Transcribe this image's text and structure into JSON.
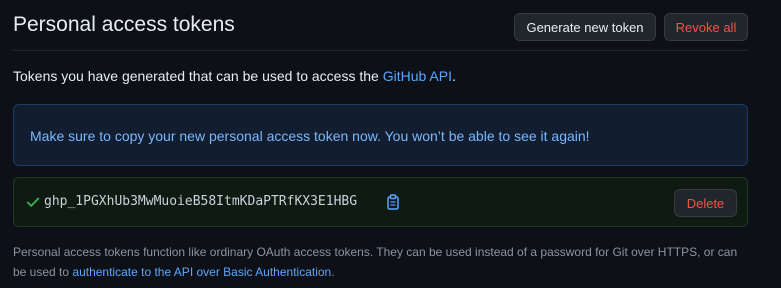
{
  "header": {
    "title": "Personal access tokens",
    "generate_label": "Generate new token",
    "revoke_label": "Revoke all"
  },
  "intro": {
    "text": "Tokens you have generated that can be used to access the ",
    "link": "GitHub API",
    "suffix": "."
  },
  "flash": {
    "message": "Make sure to copy your new personal access token now. You won’t be able to see it again!"
  },
  "token": {
    "value": "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",
    "delete_label": "Delete",
    "icons": [
      "check-icon",
      "clipboard-icon"
    ]
  },
  "note": {
    "text": "Personal access tokens function like ordinary OAuth access tokens. They can be used instead of a password for Git over HTTPS, or can be used to ",
    "link": "authenticate to the API over Basic Authentication",
    "suffix": "."
  },
  "colors": {
    "background": "#0d1117",
    "link": "#58a6ff",
    "danger": "#f85149",
    "success": "#3fb950"
  }
}
